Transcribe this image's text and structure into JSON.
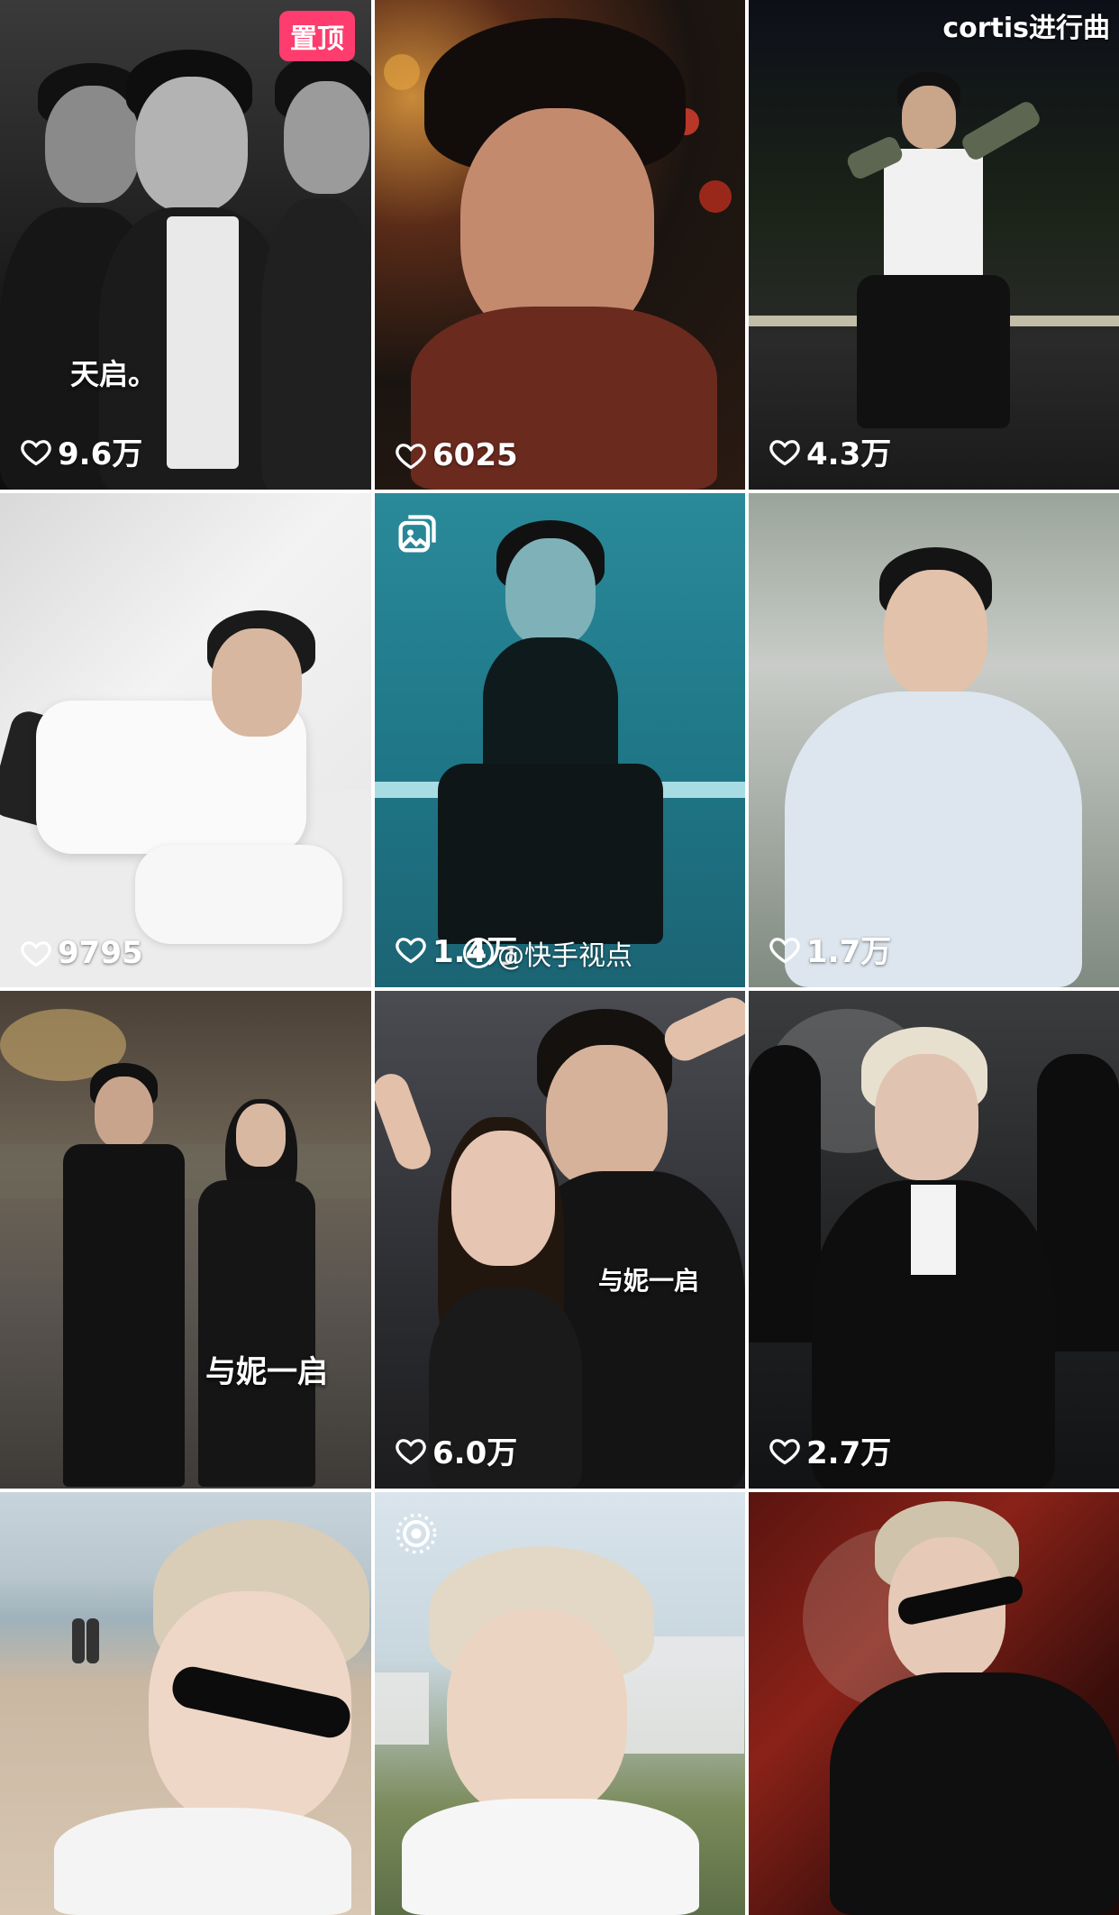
{
  "tiles": [
    {
      "likes": "9.6万",
      "badge": "置顶",
      "caption": "天启。"
    },
    {
      "likes": "6025"
    },
    {
      "likes": "4.3万",
      "corner_text": "cortis进行曲"
    },
    {
      "likes": "9795"
    },
    {
      "likes": "1.4万",
      "watermark": "@快手视点",
      "icon": "image-album-icon"
    },
    {
      "likes": "1.7万"
    },
    {
      "caption": "与妮一启"
    },
    {
      "likes": "6.0万",
      "caption": "与妮一启"
    },
    {
      "likes": "2.7万"
    },
    {},
    {
      "icon": "live-photo-icon"
    },
    {}
  ],
  "colors": {
    "pin_badge": "#fe3c6d",
    "divider": "#ffffff"
  }
}
